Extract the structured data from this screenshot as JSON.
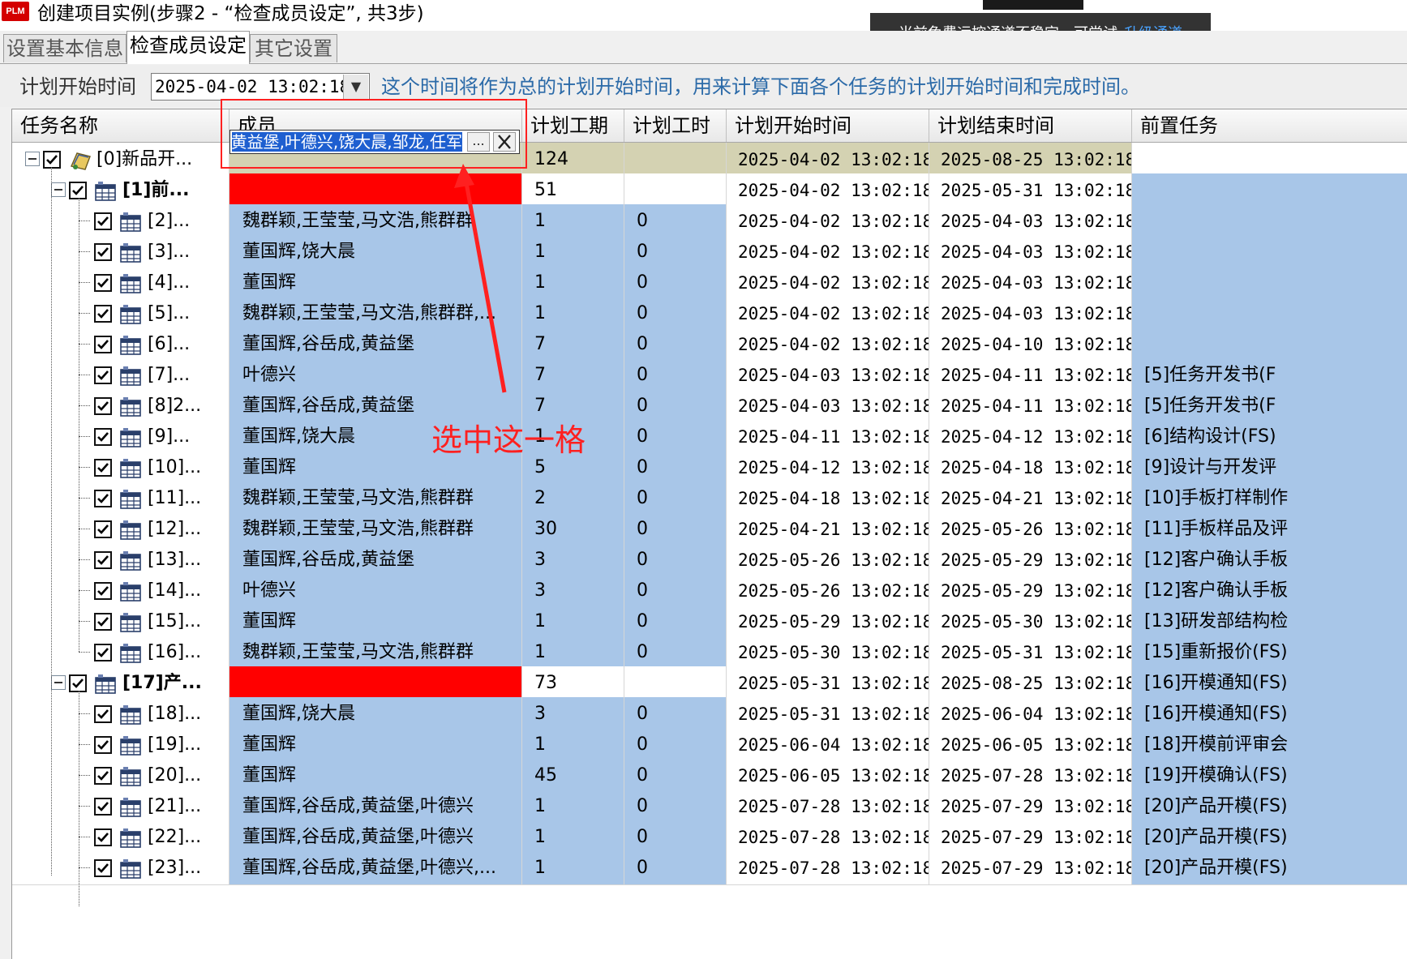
{
  "window": {
    "logo": "PLM",
    "title": "创建项目实例(步骤2 - “检查成员设定”, 共3步)"
  },
  "notice": {
    "text": "当前免费远控通道不稳定，可尝试",
    "link": "升级通道"
  },
  "tabs": [
    {
      "label": "设置基本信息",
      "active": false
    },
    {
      "label": "检查成员设定",
      "active": true
    },
    {
      "label": "其它设置",
      "active": false
    }
  ],
  "toolbar": {
    "start_label": "计划开始时间",
    "start_value": "2025-04-02 13:02:18",
    "hint": "这个时间将作为总的计划开始时间，用来计算下面各个任务的计划开始时间和完成时间。"
  },
  "columns": {
    "task": "任务名称",
    "members": "成员",
    "duration": "计划工期",
    "hours": "计划工时",
    "start": "计划开始时间",
    "end": "计划结束时间",
    "pred": "前置任务"
  },
  "editor": {
    "value": "魏群颖,王莹莹,马文浩,熊群群,董国辉,谷岳成,黄益堡,叶德兴,饶大晨,邹龙,任军,",
    "dots": "..."
  },
  "annotation": {
    "text": "选中这一格"
  },
  "rows": [
    {
      "id": "[0]新品开...",
      "level": 0,
      "members": "",
      "duration": "124",
      "hours": "",
      "start": "2025-04-02 13:02:18",
      "end": "2025-08-25 13:02:18",
      "pred": "",
      "style": "root"
    },
    {
      "id": "[1]前...",
      "level": 1,
      "members": "",
      "duration": "51",
      "hours": "",
      "start": "2025-04-02 13:02:18",
      "end": "2025-05-31 13:02:18",
      "pred": "",
      "style": "group"
    },
    {
      "id": "[2]...",
      "level": 2,
      "members": "魏群颖,王莹莹,马文浩,熊群群",
      "duration": "1",
      "hours": "0",
      "start": "2025-04-02 13:02:18",
      "end": "2025-04-03 13:02:18",
      "pred": "",
      "style": "task"
    },
    {
      "id": "[3]...",
      "level": 2,
      "members": "董国辉,饶大晨",
      "duration": "1",
      "hours": "0",
      "start": "2025-04-02 13:02:18",
      "end": "2025-04-03 13:02:18",
      "pred": "",
      "style": "task"
    },
    {
      "id": "[4]...",
      "level": 2,
      "members": "董国辉",
      "duration": "1",
      "hours": "0",
      "start": "2025-04-02 13:02:18",
      "end": "2025-04-03 13:02:18",
      "pred": "",
      "style": "task"
    },
    {
      "id": "[5]...",
      "level": 2,
      "members": "魏群颖,王莹莹,马文浩,熊群群,...",
      "duration": "1",
      "hours": "0",
      "start": "2025-04-02 13:02:18",
      "end": "2025-04-03 13:02:18",
      "pred": "",
      "style": "task"
    },
    {
      "id": "[6]...",
      "level": 2,
      "members": "董国辉,谷岳成,黄益堡",
      "duration": "7",
      "hours": "0",
      "start": "2025-04-02 13:02:18",
      "end": "2025-04-10 13:02:18",
      "pred": "",
      "style": "task"
    },
    {
      "id": "[7]...",
      "level": 2,
      "members": "叶德兴",
      "duration": "7",
      "hours": "0",
      "start": "2025-04-03 13:02:18",
      "end": "2025-04-11 13:02:18",
      "pred": "[5]任务开发书(F",
      "style": "task"
    },
    {
      "id": "[8]2...",
      "level": 2,
      "members": "董国辉,谷岳成,黄益堡",
      "duration": "7",
      "hours": "0",
      "start": "2025-04-03 13:02:18",
      "end": "2025-04-11 13:02:18",
      "pred": "[5]任务开发书(F",
      "style": "task"
    },
    {
      "id": "[9]...",
      "level": 2,
      "members": "董国辉,饶大晨",
      "duration": "1",
      "hours": "0",
      "start": "2025-04-11 13:02:18",
      "end": "2025-04-12 13:02:18",
      "pred": "[6]结构设计(FS)",
      "style": "task"
    },
    {
      "id": "[10]...",
      "level": 2,
      "members": "董国辉",
      "duration": "5",
      "hours": "0",
      "start": "2025-04-12 13:02:18",
      "end": "2025-04-18 13:02:18",
      "pred": "[9]设计与开发评",
      "style": "task"
    },
    {
      "id": "[11]...",
      "level": 2,
      "members": "魏群颖,王莹莹,马文浩,熊群群",
      "duration": "2",
      "hours": "0",
      "start": "2025-04-18 13:02:18",
      "end": "2025-04-21 13:02:18",
      "pred": "[10]手板打样制作",
      "style": "task"
    },
    {
      "id": "[12]...",
      "level": 2,
      "members": "魏群颖,王莹莹,马文浩,熊群群",
      "duration": "30",
      "hours": "0",
      "start": "2025-04-21 13:02:18",
      "end": "2025-05-26 13:02:18",
      "pred": "[11]手板样品及评",
      "style": "task"
    },
    {
      "id": "[13]...",
      "level": 2,
      "members": "董国辉,谷岳成,黄益堡",
      "duration": "3",
      "hours": "0",
      "start": "2025-05-26 13:02:18",
      "end": "2025-05-29 13:02:18",
      "pred": "[12]客户确认手板",
      "style": "task"
    },
    {
      "id": "[14]...",
      "level": 2,
      "members": "叶德兴",
      "duration": "3",
      "hours": "0",
      "start": "2025-05-26 13:02:18",
      "end": "2025-05-29 13:02:18",
      "pred": "[12]客户确认手板",
      "style": "task"
    },
    {
      "id": "[15]...",
      "level": 2,
      "members": "董国辉",
      "duration": "1",
      "hours": "0",
      "start": "2025-05-29 13:02:18",
      "end": "2025-05-30 13:02:18",
      "pred": "[13]研发部结构检",
      "style": "task"
    },
    {
      "id": "[16]...",
      "level": 2,
      "members": "魏群颖,王莹莹,马文浩,熊群群",
      "duration": "1",
      "hours": "0",
      "start": "2025-05-30 13:02:18",
      "end": "2025-05-31 13:02:18",
      "pred": "[15]重新报价(FS)",
      "style": "task"
    },
    {
      "id": "[17]产...",
      "level": 1,
      "members": "",
      "duration": "73",
      "hours": "",
      "start": "2025-05-31 13:02:18",
      "end": "2025-08-25 13:02:18",
      "pred": "[16]开模通知(FS)",
      "style": "group"
    },
    {
      "id": "[18]...",
      "level": 2,
      "members": "董国辉,饶大晨",
      "duration": "3",
      "hours": "0",
      "start": "2025-05-31 13:02:18",
      "end": "2025-06-04 13:02:18",
      "pred": "[16]开模通知(FS)",
      "style": "task"
    },
    {
      "id": "[19]...",
      "level": 2,
      "members": "董国辉",
      "duration": "1",
      "hours": "0",
      "start": "2025-06-04 13:02:18",
      "end": "2025-06-05 13:02:18",
      "pred": "[18]开模前评审会",
      "style": "task"
    },
    {
      "id": "[20]...",
      "level": 2,
      "members": "董国辉",
      "duration": "45",
      "hours": "0",
      "start": "2025-06-05 13:02:18",
      "end": "2025-07-28 13:02:18",
      "pred": "[19]开模确认(FS)",
      "style": "task"
    },
    {
      "id": "[21]...",
      "level": 2,
      "members": "董国辉,谷岳成,黄益堡,叶德兴",
      "duration": "1",
      "hours": "0",
      "start": "2025-07-28 13:02:18",
      "end": "2025-07-29 13:02:18",
      "pred": "[20]产品开模(FS)",
      "style": "task"
    },
    {
      "id": "[22]...",
      "level": 2,
      "members": "董国辉,谷岳成,黄益堡,叶德兴",
      "duration": "1",
      "hours": "0",
      "start": "2025-07-28 13:02:18",
      "end": "2025-07-29 13:02:18",
      "pred": "[20]产品开模(FS)",
      "style": "task"
    },
    {
      "id": "[23]...",
      "level": 2,
      "members": "董国辉,谷岳成,黄益堡,叶德兴,...",
      "duration": "1",
      "hours": "0",
      "start": "2025-07-28 13:02:18",
      "end": "2025-07-29 13:02:18",
      "pred": "[20]产品开模(FS)",
      "style": "task"
    }
  ],
  "colors": {
    "selection_blue": "#a8c6e8",
    "highlight_red": "#ff0000",
    "root_row": "#d4d2b2",
    "annotation": "#ff2020",
    "editor_select": "#1e5fd0"
  },
  "icons": {
    "expand": "collapse-minus-icon",
    "check": "checkbox-checked-icon",
    "task": "task-table-icon",
    "root": "project-folder-icon"
  }
}
